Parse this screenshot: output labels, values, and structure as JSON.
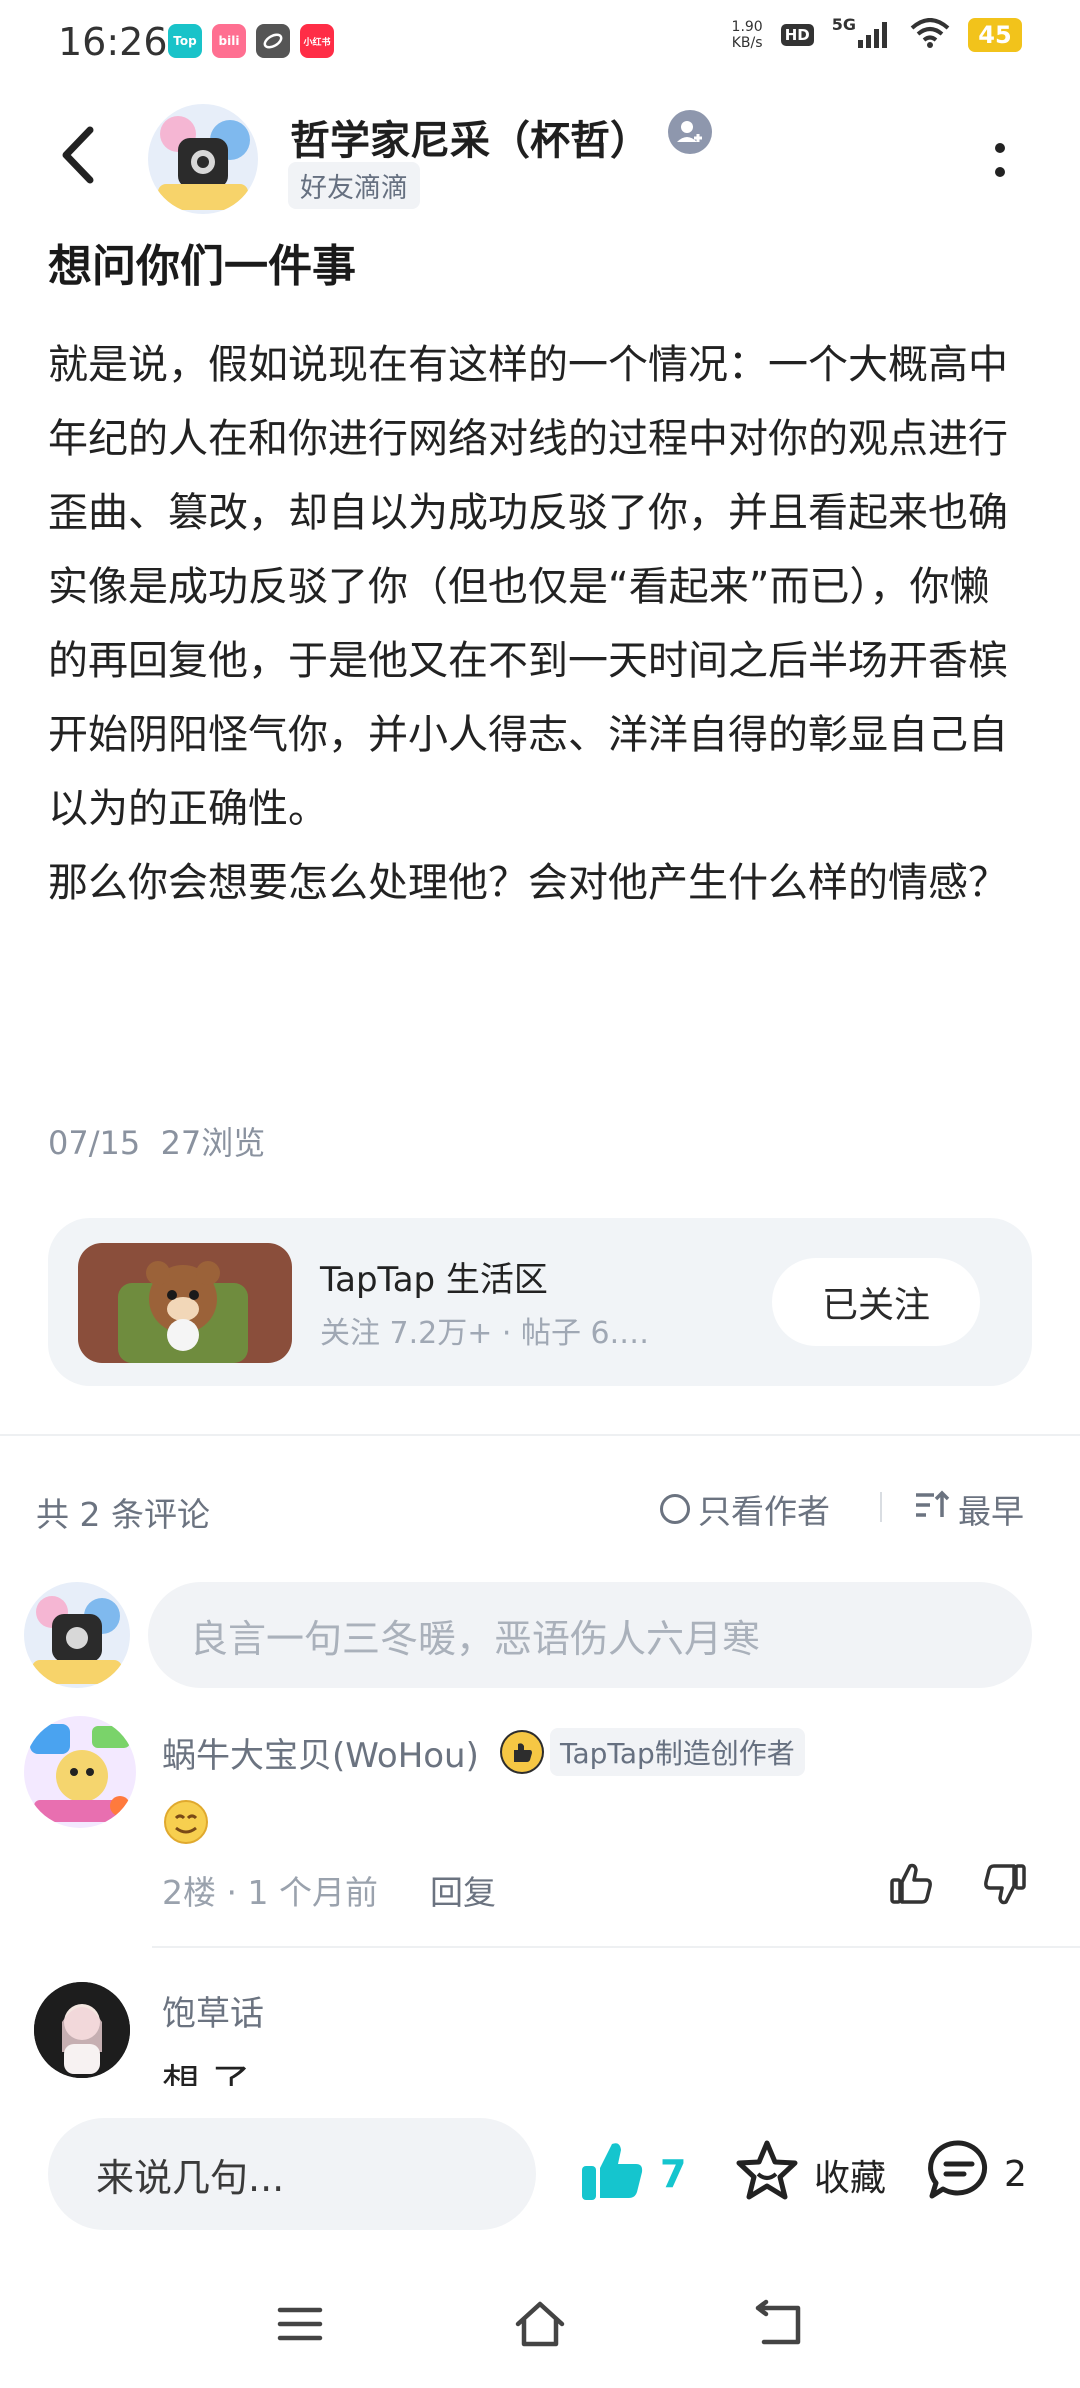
{
  "status_bar": {
    "time": "16:26",
    "app_icons": [
      {
        "label": "Top",
        "color": "#19c3c9"
      },
      {
        "label": "bili",
        "color": "#ff6f91"
      },
      {
        "label": "",
        "color": "#555555"
      },
      {
        "label": "小红书",
        "color": "#ff2d46"
      }
    ],
    "net_speed_value": "1.90",
    "net_speed_unit": "KB/s",
    "hd": "HD",
    "network": "5G",
    "battery": "45"
  },
  "header": {
    "author_name": "哲学家尼采（杯哲）",
    "author_tag": "好友滴滴"
  },
  "post": {
    "title": "想问你们一件事",
    "paragraphs": [
      "就是说，假如说现在有这样的一个情况：一个大概高中年纪的人在和你进行网络对线的过程中对你的观点进行歪曲、篡改，却自以为成功反驳了你，并且看起来也确实像是成功反驳了你（但也仅是“看起来”而已），你懒的再回复他，于是他又在不到一天时间之后半场开香槟开始阴阳怪气你，并小人得志、洋洋自得的彰显自己自以为的正确性。",
      "那么你会想要怎么处理他？会对他产生什么样的情感？"
    ],
    "date": "07/15",
    "views": "27浏览"
  },
  "forum": {
    "name": "TapTap 生活区",
    "stats": "关注 7.2万+  ·  帖子 6.…",
    "followed_label": "已关注"
  },
  "comments_header": {
    "count_label": "共 2 条评论",
    "only_author_label": "只看作者",
    "sort_label": "最早"
  },
  "comment_input": {
    "placeholder": "良言一句三冬暖，恶语伤人六月寒"
  },
  "comments": [
    {
      "name": "蜗牛大宝贝(WoHou)",
      "badge": "TapTap制造创作者",
      "floor_time": "2楼  ·  1 个月前",
      "reply_label": "回复"
    },
    {
      "name": "饱草话",
      "text": "想    了"
    }
  ],
  "bottom_bar": {
    "say_placeholder": "来说几句...",
    "vote_count": "7",
    "fav_label": "收藏",
    "comment_count": "2"
  },
  "colors": {
    "accent": "#15c5ce",
    "card_bg": "#f1f4f7"
  }
}
